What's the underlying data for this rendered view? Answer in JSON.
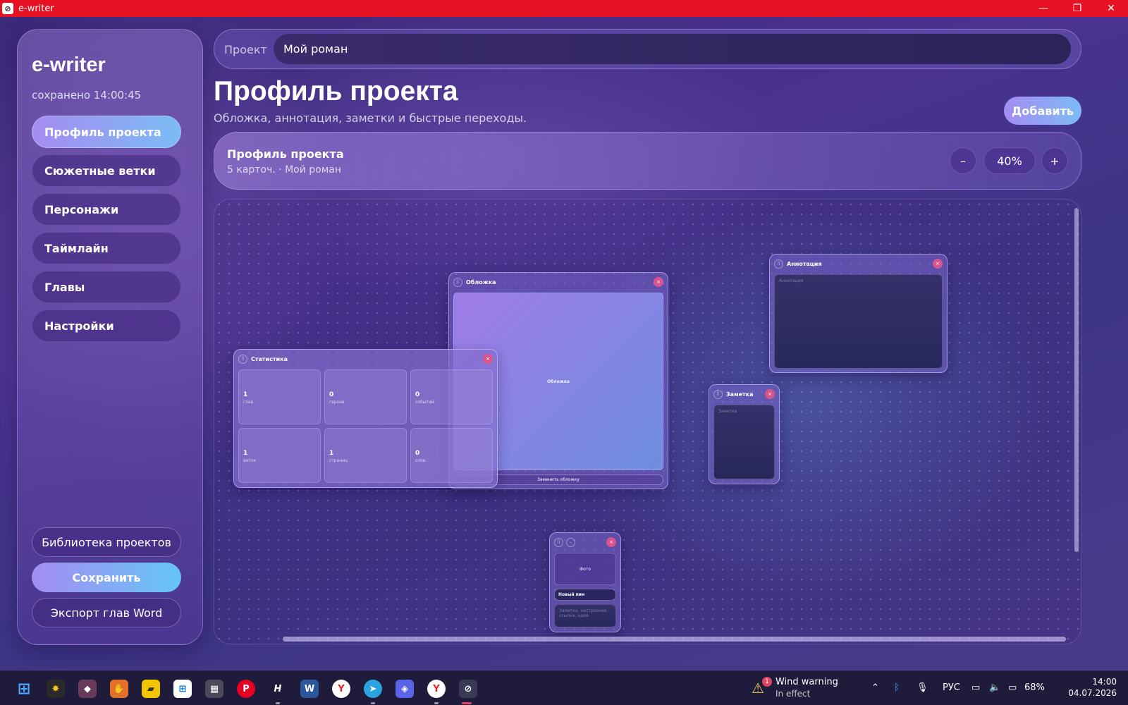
{
  "window": {
    "title": "e-writer",
    "minimize": "—",
    "restore": "❐",
    "close": "✕"
  },
  "sidebar": {
    "brand": "e-writer",
    "saved": "сохранено 14:00:45",
    "items": [
      {
        "label": "Профиль проекта",
        "active": true
      },
      {
        "label": "Сюжетные ветки"
      },
      {
        "label": "Персонажи"
      },
      {
        "label": "Таймлайн"
      },
      {
        "label": "Главы"
      },
      {
        "label": "Настройки"
      }
    ],
    "library_label": "Библиотека проектов",
    "save_label": "Сохранить",
    "export_label": "Экспорт глав Word"
  },
  "project": {
    "label": "Проект",
    "name": "Мой роман"
  },
  "page": {
    "title": "Профиль проекта",
    "subtitle": "Обложка, аннотация, заметки и быстрые переходы.",
    "add_label": "Добавить"
  },
  "canvas_header": {
    "title": "Профиль проекта",
    "subtitle": "5 карточ. · Мой роман",
    "zoom_out": "–",
    "zoom": "40%",
    "zoom_in": "+"
  },
  "cards": {
    "cover": {
      "title": "Обложка",
      "placeholder": "Обложка",
      "replace_label": "Заменить обложку"
    },
    "stats": {
      "title": "Статистика",
      "items": [
        {
          "value": "1",
          "label": "глав"
        },
        {
          "value": "0",
          "label": "героев"
        },
        {
          "value": "0",
          "label": "событий"
        },
        {
          "value": "1",
          "label": "веток"
        },
        {
          "value": "1",
          "label": "страниц"
        },
        {
          "value": "0",
          "label": "слов"
        }
      ]
    },
    "annotation": {
      "title": "Аннотация",
      "placeholder": "Аннотация"
    },
    "note": {
      "title": "Заметка",
      "placeholder": "Заметка"
    },
    "pin": {
      "photo": "Фото",
      "name": "Новый пин",
      "placeholder": "Заметка, настроение, ссылка, идея"
    }
  },
  "taskbar": {
    "weather_title": "Wind warning",
    "weather_sub": "In effect",
    "weather_badge": "1",
    "lang": "РУС",
    "battery": "68%",
    "time": "14:00",
    "date": "04.07.2026"
  },
  "colors": {
    "titlebar": "#e81123",
    "accent_from": "#a58cf2",
    "accent_to": "#7bbcf5",
    "close_badge": "#d9558d"
  }
}
